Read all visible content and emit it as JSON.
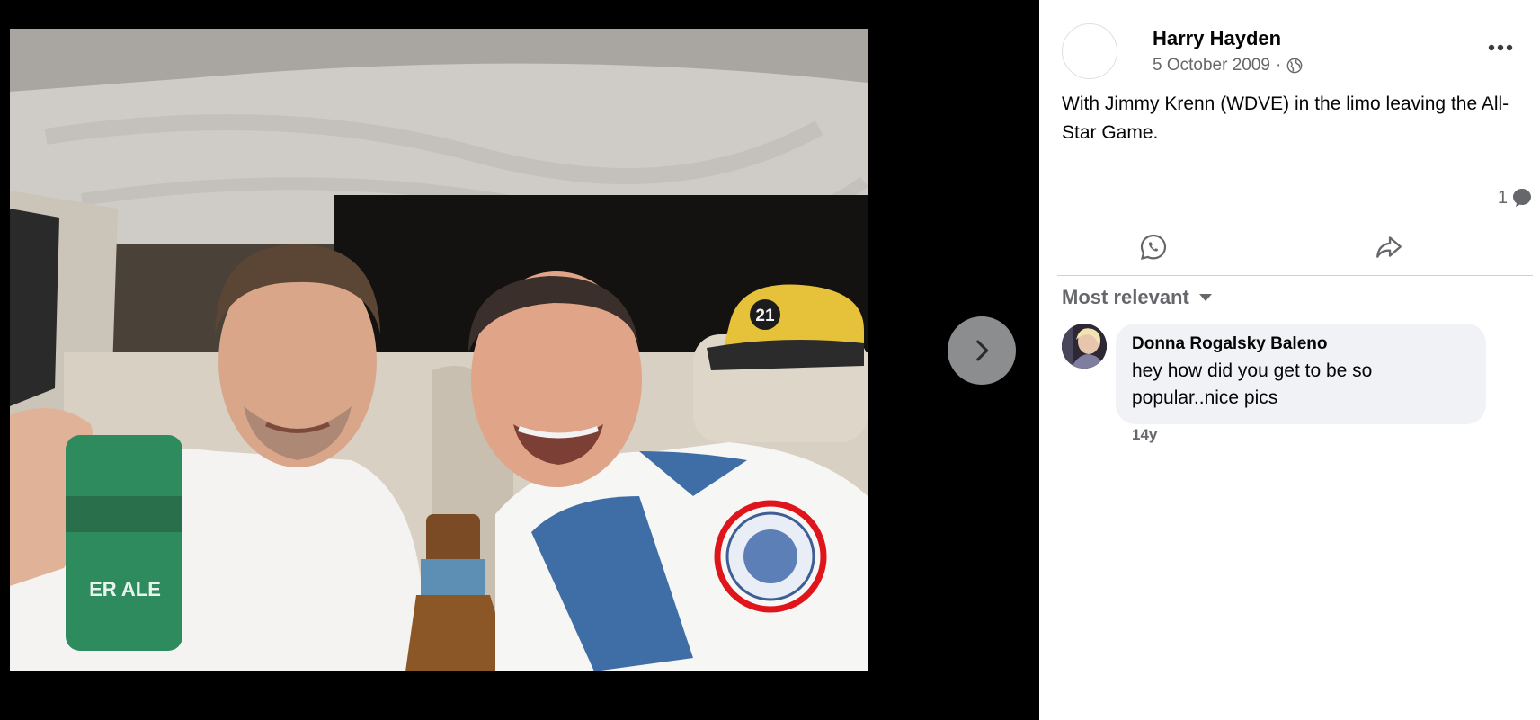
{
  "post": {
    "author": "Harry Hayden",
    "date": "5 October 2009",
    "separator": "·",
    "privacy_icon": "globe-icon",
    "caption": "With Jimmy Krenn (WDVE) in the limo leaving the All-Star Game.",
    "comment_count": "1"
  },
  "photo": {
    "hat_number": "21",
    "can_text": "ER ALE"
  },
  "actions": {
    "whatsapp_icon": "whatsapp-icon",
    "share_icon": "share-icon"
  },
  "comments_section": {
    "sort_label": "Most relevant"
  },
  "comments": [
    {
      "author": "Donna Rogalsky Baleno",
      "text": "hey how did you get to be so popular..nice pics",
      "time": "14y"
    }
  ],
  "colors": {
    "viewer_bg": "#000000",
    "panel_bg": "#ffffff",
    "secondary_text": "#65676b",
    "bubble_bg": "#f0f2f5",
    "highlight_circle": "#e0141b"
  }
}
